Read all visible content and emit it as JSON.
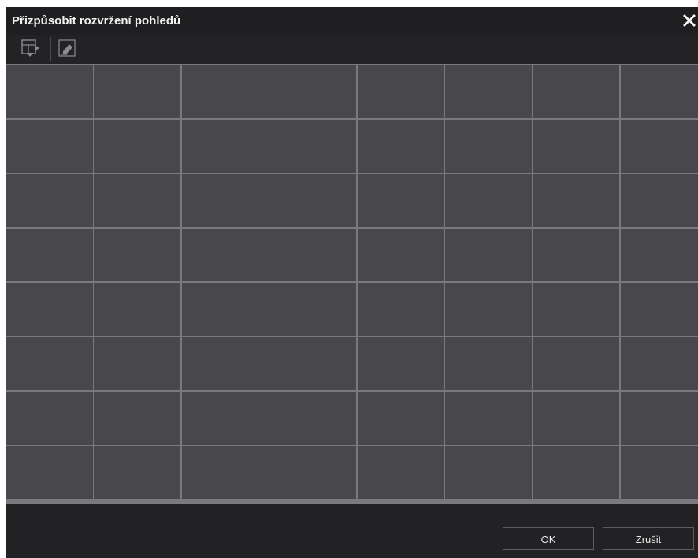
{
  "dialog": {
    "title": "Přizpůsobit rozvržení pohledů",
    "close_icon": "close-icon"
  },
  "toolbar": {
    "items": [
      {
        "icon": "layout-split-icon"
      },
      {
        "icon": "eraser-icon"
      }
    ]
  },
  "layout_grid": {
    "rows": 8,
    "columns": 8
  },
  "footer": {
    "ok_label": "OK",
    "cancel_label": "Zrušit"
  },
  "colors": {
    "title_bar": "#1f1f21",
    "cell": "#48484c",
    "grid_line": "#7a7a7e",
    "footer": "#222225"
  }
}
